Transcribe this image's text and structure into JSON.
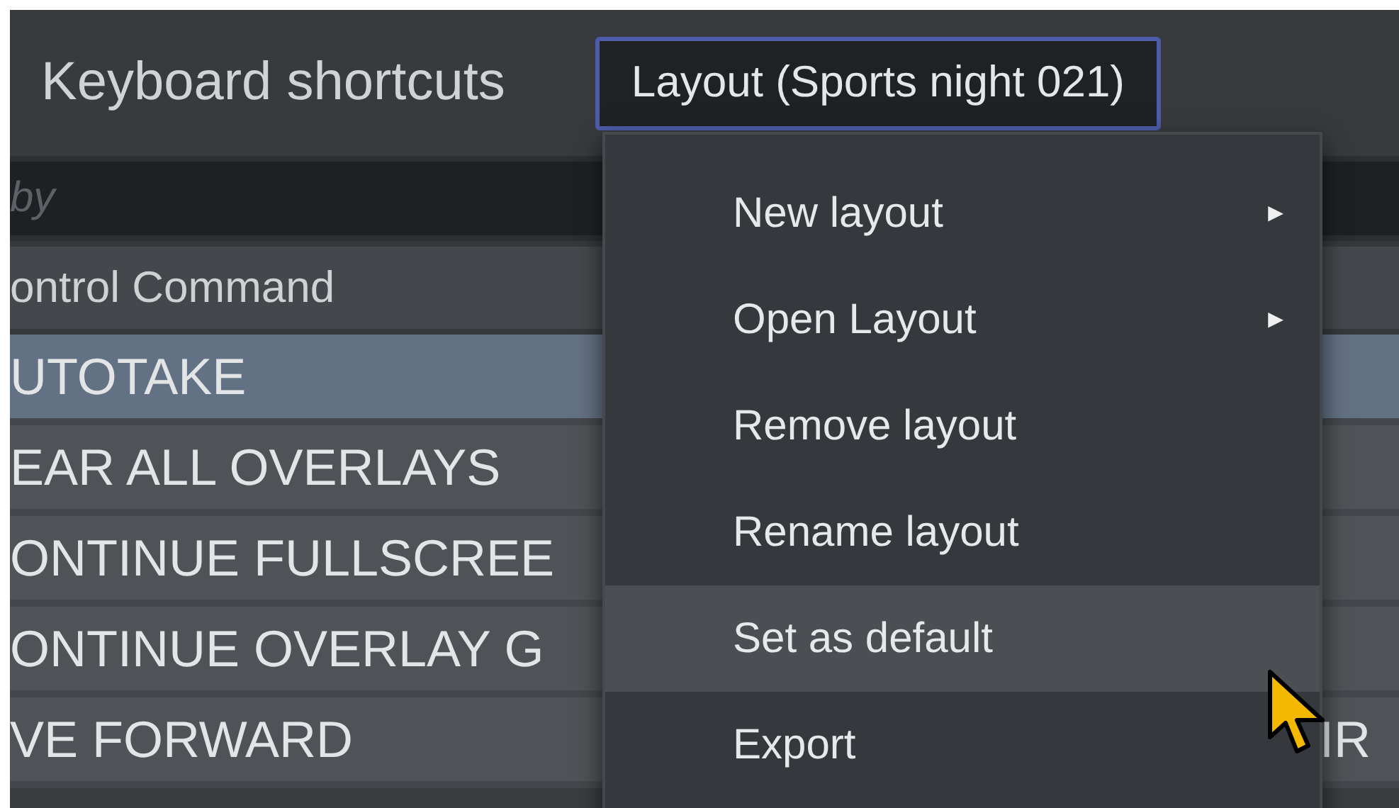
{
  "header": {
    "title": "Keyboard shortcuts",
    "layout_button": "Layout (Sports night 021)"
  },
  "search": {
    "placeholder": "by"
  },
  "table": {
    "columns": [
      "ontrol Command"
    ],
    "rows": [
      {
        "cells": [
          "UTOTAKE"
        ],
        "selected": true
      },
      {
        "cells": [
          "EAR ALL OVERLAYS"
        ],
        "selected": false
      },
      {
        "cells": [
          "ONTINUE FULLSCREE"
        ],
        "selected": false
      },
      {
        "cells": [
          "ONTINUE OVERLAY G"
        ],
        "selected": false
      },
      {
        "cells": [
          "VE FORWARD",
          "IR"
        ],
        "selected": false
      }
    ]
  },
  "menu": {
    "items": [
      {
        "label": "New layout",
        "arrow": "►",
        "highlighted": false
      },
      {
        "label": "Open Layout",
        "arrow": "►",
        "highlighted": false
      },
      {
        "label": "Remove layout",
        "highlighted": false
      },
      {
        "label": "Rename layout",
        "highlighted": false
      },
      {
        "label": "Set as default",
        "highlighted": true
      },
      {
        "label": "Export",
        "highlighted": false
      }
    ]
  }
}
